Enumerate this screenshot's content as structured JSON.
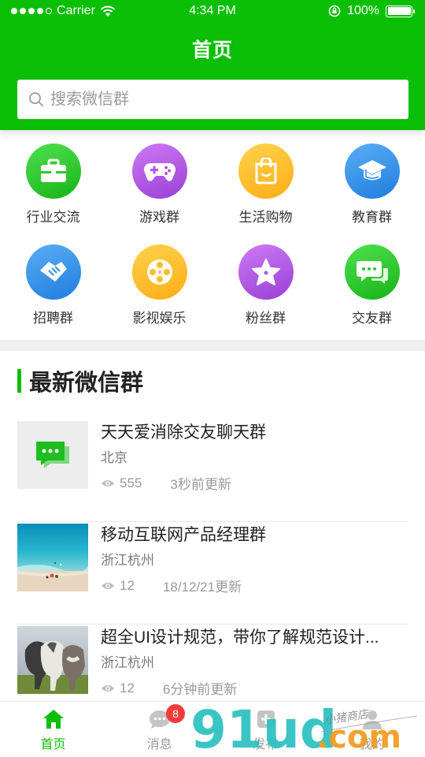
{
  "status_bar": {
    "carrier": "Carrier",
    "time": "4:34 PM",
    "battery": "100%"
  },
  "header": {
    "title": "首页"
  },
  "search": {
    "placeholder": "搜索微信群"
  },
  "categories": [
    {
      "label": "行业交流",
      "icon": "briefcase-icon",
      "color": "#2ec82e"
    },
    {
      "label": "游戏群",
      "icon": "gamepad-icon",
      "color": "#b156e4"
    },
    {
      "label": "生活购物",
      "icon": "shopping-bag-icon",
      "color": "#ffbe28"
    },
    {
      "label": "教育群",
      "icon": "graduation-cap-icon",
      "color": "#2f8fe8"
    },
    {
      "label": "招聘群",
      "icon": "handshake-icon",
      "color": "#2f8fe8"
    },
    {
      "label": "影视娱乐",
      "icon": "film-reel-icon",
      "color": "#ffbe28"
    },
    {
      "label": "粉丝群",
      "icon": "star-icon",
      "color": "#b156e4"
    },
    {
      "label": "交友群",
      "icon": "chat-bubbles-icon",
      "color": "#2ec82e"
    }
  ],
  "section": {
    "title": "最新微信群"
  },
  "groups": [
    {
      "title": "天天爱消除交友聊天群",
      "location": "北京",
      "views": "555",
      "updated": "3秒前更新",
      "thumb": "chat-placeholder"
    },
    {
      "title": "移动互联网产品经理群",
      "location": "浙江杭州",
      "views": "12",
      "updated": "18/12/21更新",
      "thumb": "beach-photo"
    },
    {
      "title": "超全UI设计规范，带你了解规范设计...",
      "location": "浙江杭州",
      "views": "12",
      "updated": "6分钟前更新",
      "thumb": "horses-photo"
    }
  ],
  "tabbar": {
    "tabs": [
      {
        "label": "首页",
        "icon": "home-icon",
        "active": true
      },
      {
        "label": "消息",
        "icon": "message-icon",
        "badge": "8"
      },
      {
        "label": "发布",
        "icon": "publish-icon"
      },
      {
        "label": "我的",
        "icon": "profile-icon"
      }
    ]
  },
  "watermark": {
    "text": "91ud.com",
    "subtext": "小猪商店"
  },
  "colors": {
    "brand_green": "#0bbe06",
    "badge_red": "#f23c3c"
  }
}
